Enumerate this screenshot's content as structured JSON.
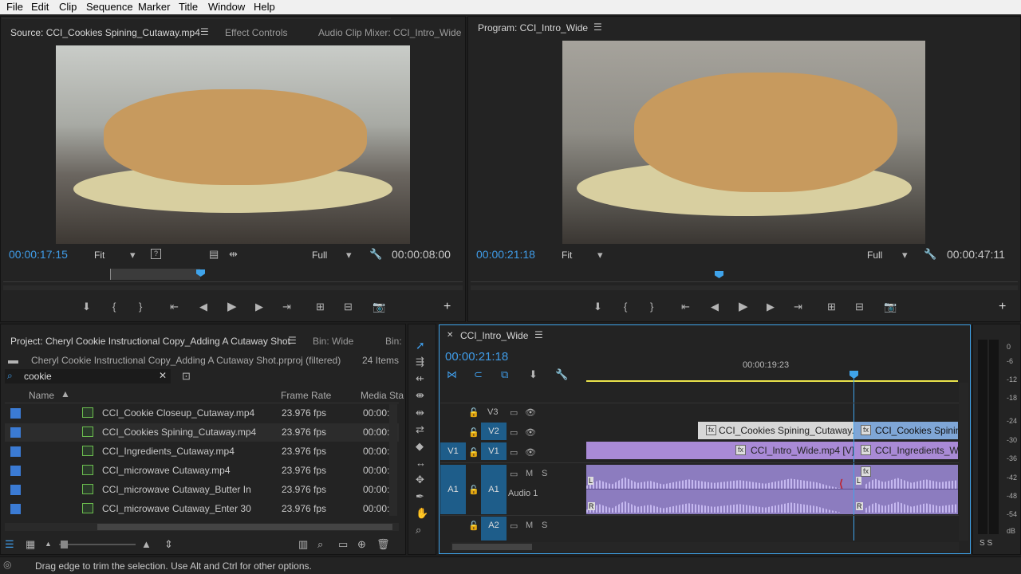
{
  "menu": [
    "File",
    "Edit",
    "Clip",
    "Sequence",
    "Marker",
    "Title",
    "Window",
    "Help"
  ],
  "source": {
    "tab": "Source: CCI_Cookies Spining_Cutaway.mp4",
    "tab2": "Effect Controls",
    "tab3": "Audio Clip Mixer: CCI_Intro_Wide",
    "timecode": "00:00:17:15",
    "fit": "Fit",
    "quality": "Full",
    "duration": "00:00:08:00"
  },
  "program": {
    "tab": "Program: CCI_Intro_Wide",
    "timecode": "00:00:21:18",
    "fit": "Fit",
    "quality": "Full",
    "duration": "00:00:47:11"
  },
  "project": {
    "tab": "Project: Cheryl Cookie Instructional Copy_Adding A Cutaway Shot",
    "tab2": "Bin: Wide",
    "tab3": "Bin:",
    "file": "Cheryl Cookie Instructional Copy_Adding A Cutaway Shot.prproj (filtered)",
    "count": "24 Items",
    "search": "cookie",
    "cols": {
      "name": "Name",
      "fps": "Frame Rate",
      "media": "Media Sta"
    },
    "rows": [
      {
        "name": "CCI_Cookie Closeup_Cutaway.mp4",
        "fps": "23.976 fps",
        "media": "00:00:"
      },
      {
        "name": "CCI_Cookies Spining_Cutaway.mp4",
        "fps": "23.976 fps",
        "media": "00:00:"
      },
      {
        "name": "CCI_Ingredients_Cutaway.mp4",
        "fps": "23.976 fps",
        "media": "00:00:"
      },
      {
        "name": "CCI_microwave Cutaway.mp4",
        "fps": "23.976 fps",
        "media": "00:00:"
      },
      {
        "name": "CCI_microwave Cutaway_Butter In",
        "fps": "23.976 fps",
        "media": "00:00:"
      },
      {
        "name": "CCI_microwave Cutaway_Enter 30",
        "fps": "23.976 fps",
        "media": "00:00:"
      }
    ]
  },
  "timeline": {
    "tab": "CCI_Intro_Wide",
    "timecode": "00:00:21:18",
    "ruler": "00:00:19:23",
    "tracks": {
      "v3": "V3",
      "v2": "V2",
      "v1": "V1",
      "a1": "A1",
      "a2": "A2",
      "src_v1": "V1",
      "src_a1": "A1",
      "audio_name": "Audio 1",
      "m": "M",
      "s": "S"
    },
    "clips": {
      "v2a": "CCI_Cookies Spining_Cutaway.mp4",
      "v2b": "CCI_Cookies Spining",
      "v1a": "CCI_Intro_Wide.mp4 [V]",
      "v1b": "CCI_Ingredients_Wi"
    }
  },
  "meter": {
    "labels": [
      "0",
      "-6",
      "-12",
      "-18",
      "-24",
      "-30",
      "-36",
      "-42",
      "-48",
      "-54",
      "dB"
    ],
    "solo": "S S"
  },
  "status": "Drag edge to trim the selection. Use Alt and Ctrl for other options."
}
